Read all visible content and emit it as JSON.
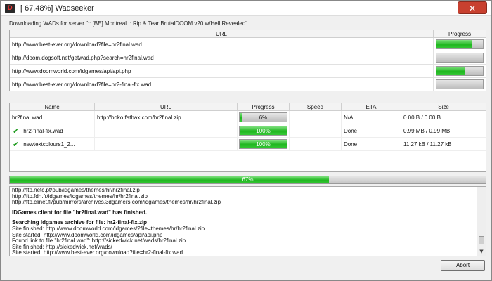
{
  "window": {
    "title": "[ 67.48%] Wadseeker",
    "icon": "doom-app-icon",
    "close_glyph": "✕"
  },
  "status_text": "Downloading WADs for server \":: [BE] Montreal :: Rip & Tear BrutalDOOM v20 w/Hell Revealed\"",
  "url_table": {
    "headers": {
      "url": "URL",
      "progress": "Progress"
    },
    "rows": [
      {
        "url": "http://www.best-ever.org/download?file=hr2final.wad",
        "progress": 0.78
      },
      {
        "url": "http://doom.dogsoft.net/getwad.php?search=hr2final.wad",
        "progress": 0
      },
      {
        "url": "http://www.doomworld.com/idgames/api/api.php",
        "progress": 0.6
      },
      {
        "url": "http://www.best-ever.org/download?file=hr2-final-fix.wad",
        "progress": 0
      }
    ]
  },
  "download_table": {
    "headers": {
      "name": "Name",
      "url": "URL",
      "progress": "Progress",
      "speed": "Speed",
      "eta": "ETA",
      "size": "Size"
    },
    "rows": [
      {
        "done": false,
        "name": "hr2final.wad",
        "url": "http://boko.fathax.com/hr2final.zip",
        "progress_label": "6%",
        "progress": 0.06,
        "speed": "",
        "eta": "N/A",
        "size": "0.00 B / 0.00 B"
      },
      {
        "done": true,
        "name": "hr2-final-fix.wad",
        "url": "",
        "progress_label": "100%",
        "progress": 1,
        "speed": "",
        "eta": "Done",
        "size": "0.99 MB / 0.99 MB"
      },
      {
        "done": true,
        "name": "newtextcolours1_2...",
        "url": "",
        "progress_label": "100%",
        "progress": 1,
        "speed": "",
        "eta": "Done",
        "size": "11.27 kB / 11.27 kB"
      }
    ]
  },
  "overall_progress": {
    "label": "67%",
    "value": 0.67
  },
  "log": [
    {
      "text": "http://ftp.netc.pt/pub/idgames/themes/hr/hr2final.zip",
      "bold": false
    },
    {
      "text": "http://ftp.fdn.fr/idgames/idgames/themes/hr/hr2final.zip",
      "bold": false
    },
    {
      "text": "http://ftp.clinet.fi/pub/mirrors/archives.3dgamers.com/idgames/themes/hr/hr2final.zip",
      "bold": false
    },
    {
      "text": "",
      "bold": false,
      "gap": true
    },
    {
      "text": "IDGames client for file \"hr2final.wad\" has finished.",
      "bold": true
    },
    {
      "text": "",
      "bold": false,
      "gap": true
    },
    {
      "text": "Searching Idgames archive for file: hr2-final-fix.zip",
      "bold": true
    },
    {
      "text": "Site finished: http://www.doomworld.com/idgames/?file=themes/hr/hr2final.zip",
      "bold": false
    },
    {
      "text": "Site started: http://www.doomworld.com/idgames/api/api.php",
      "bold": false
    },
    {
      "text": "Found link to file \"hr2final.wad\": http://sickedwick.net/wads/hr2final.zip",
      "bold": false
    },
    {
      "text": "Site finished: http://sickedwick.net/wads/",
      "bold": false
    },
    {
      "text": "Site started: http://www.best-ever.org/download?file=hr2-final-fix.wad",
      "bold": false
    }
  ],
  "abort_label": "Abort",
  "colors": {
    "progress_green": "#1fb61f",
    "close_red": "#c8402f"
  }
}
